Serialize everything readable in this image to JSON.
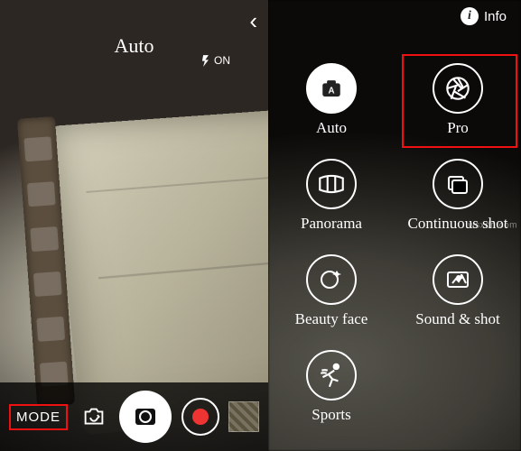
{
  "left": {
    "back_glyph": "‹",
    "current_mode": "Auto",
    "flash_state": "ON",
    "mode_button": "MODE"
  },
  "right": {
    "info_label": "Info",
    "info_glyph": "i",
    "modes": {
      "auto": {
        "label": "Auto"
      },
      "pro": {
        "label": "Pro"
      },
      "panorama": {
        "label": "Panorama"
      },
      "continuous": {
        "label": "Continuous shot"
      },
      "beauty": {
        "label": "Beauty face"
      },
      "soundshot": {
        "label": "Sound & shot"
      },
      "sports": {
        "label": "Sports"
      }
    }
  },
  "watermark": "wsxdn.com"
}
